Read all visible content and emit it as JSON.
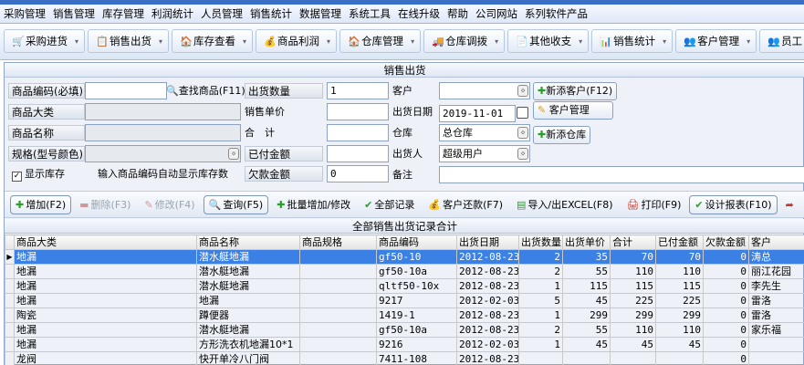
{
  "menu": [
    "采购管理",
    "销售管理",
    "库存管理",
    "利润统计",
    "人员管理",
    "销售统计",
    "数据管理",
    "系统工具",
    "在线升级",
    "帮助",
    "公司网站",
    "系列软件产品"
  ],
  "toolbar": [
    {
      "icon": "cart-icon",
      "glyph": "🛒",
      "label": "采购进货"
    },
    {
      "icon": "sales-out-icon",
      "glyph": "📋",
      "label": "销售出货"
    },
    {
      "icon": "warehouse-icon",
      "glyph": "🏠",
      "label": "库存查看"
    },
    {
      "icon": "profit-icon",
      "glyph": "💰",
      "label": "商品利润"
    },
    {
      "icon": "storage-icon",
      "glyph": "🏠",
      "label": "仓库管理"
    },
    {
      "icon": "transfer-icon",
      "glyph": "🚚",
      "label": "仓库调拨"
    },
    {
      "icon": "income-expense-icon",
      "glyph": "📄",
      "label": "其他收支"
    },
    {
      "icon": "statistics-icon",
      "glyph": "📊",
      "label": "销售统计"
    },
    {
      "icon": "customer-icon",
      "glyph": "👥",
      "label": "客户管理"
    },
    {
      "icon": "staff-icon",
      "glyph": "👥",
      "label": "员工"
    }
  ],
  "form": {
    "title": "销售出货",
    "product_code_label": "商品编码(必填)",
    "find_product": "查找商品(F11)",
    "ship_qty_label": "出货数量",
    "ship_qty_value": "1",
    "customer_label": "客户",
    "customer_value": "",
    "add_customer": "新添客户(F12)",
    "category_label": "商品大类",
    "unit_price_label": "销售单价",
    "ship_date_label": "出货日期",
    "ship_date_value": "2019-11-01",
    "customer_manage": "客户管理",
    "product_name_label": "商品名称",
    "total_label": "合　计",
    "warehouse_label": "仓库",
    "warehouse_value": "总仓库",
    "add_warehouse": "新添仓库",
    "spec_label": "规格(型号颜色)",
    "paid_label": "已付金额",
    "shipper_label": "出货人",
    "shipper_value": "超级用户",
    "show_stock_label": "显示库存",
    "hint": "输入商品编码自动显示库存数",
    "owed_label": "欠款金额",
    "owed_value": "0",
    "remark_label": "备注"
  },
  "actions": [
    {
      "icon": "add-icon",
      "glyph": "✚",
      "label": "增加(F2)",
      "style": "box"
    },
    {
      "icon": "delete-icon",
      "glyph": "▬",
      "label": "删除(F3)",
      "style": "disabled"
    },
    {
      "icon": "edit-icon",
      "glyph": "✎",
      "label": "修改(F4)",
      "style": "disabled"
    },
    {
      "icon": "query-icon",
      "glyph": "🔍",
      "label": "查询(F5)",
      "style": "box"
    },
    {
      "icon": "batch-icon",
      "glyph": "✚",
      "label": "批量增加/修改",
      "style": ""
    },
    {
      "icon": "check-icon",
      "glyph": "✔",
      "label": "全部记录",
      "style": ""
    },
    {
      "icon": "refund-icon",
      "glyph": "💰",
      "label": "客户还款(F7)",
      "style": ""
    },
    {
      "icon": "excel-icon",
      "glyph": "▤",
      "label": "导入/出EXCEL(F8)",
      "style": ""
    },
    {
      "icon": "print-icon",
      "glyph": "🖨",
      "label": "打印(F9)",
      "style": ""
    },
    {
      "icon": "report-design-icon",
      "glyph": "✔",
      "label": "设计报表(F10)",
      "style": "box"
    },
    {
      "icon": "exit-icon",
      "glyph": "➦",
      "label": "",
      "style": ""
    }
  ],
  "table": {
    "title": "全部销售出货记录合计",
    "columns": [
      "商品大类",
      "商品名称",
      "商品规格",
      "商品编码",
      "出货日期",
      "出货数量",
      "出货单价",
      "合计",
      "已付金额",
      "欠款金额",
      "客户"
    ],
    "rows": [
      [
        "地漏",
        "潜水艇地漏",
        "",
        "gf50-10",
        "2012-08-23",
        "2",
        "35",
        "70",
        "70",
        "0",
        "涛总"
      ],
      [
        "地漏",
        "潜水艇地漏",
        "",
        "gf50-10a",
        "2012-08-23",
        "2",
        "55",
        "110",
        "110",
        "0",
        "丽江花园"
      ],
      [
        "地漏",
        "潜水艇地漏",
        "",
        "qltf50-10x",
        "2012-08-23",
        "1",
        "115",
        "115",
        "115",
        "0",
        "李先生"
      ],
      [
        "地漏",
        "地漏",
        "",
        "9217",
        "2012-02-03",
        "5",
        "45",
        "225",
        "225",
        "0",
        "雷洛"
      ],
      [
        "陶瓷",
        "蹲便器",
        "",
        "1419-1",
        "2012-08-23",
        "1",
        "299",
        "299",
        "299",
        "0",
        "雷洛"
      ],
      [
        "地漏",
        "潜水艇地漏",
        "",
        "gf50-10a",
        "2012-08-23",
        "2",
        "55",
        "110",
        "110",
        "0",
        "家乐福"
      ],
      [
        "地漏",
        "方形洗衣机地漏10*1",
        "",
        "9216",
        "2012-02-03",
        "1",
        "45",
        "45",
        "45",
        "0",
        ""
      ],
      [
        "龙阀",
        "快开单冷八门阀",
        "",
        "7411-108",
        "2012-08-23",
        "",
        "",
        "",
        "",
        "0",
        ""
      ]
    ]
  }
}
